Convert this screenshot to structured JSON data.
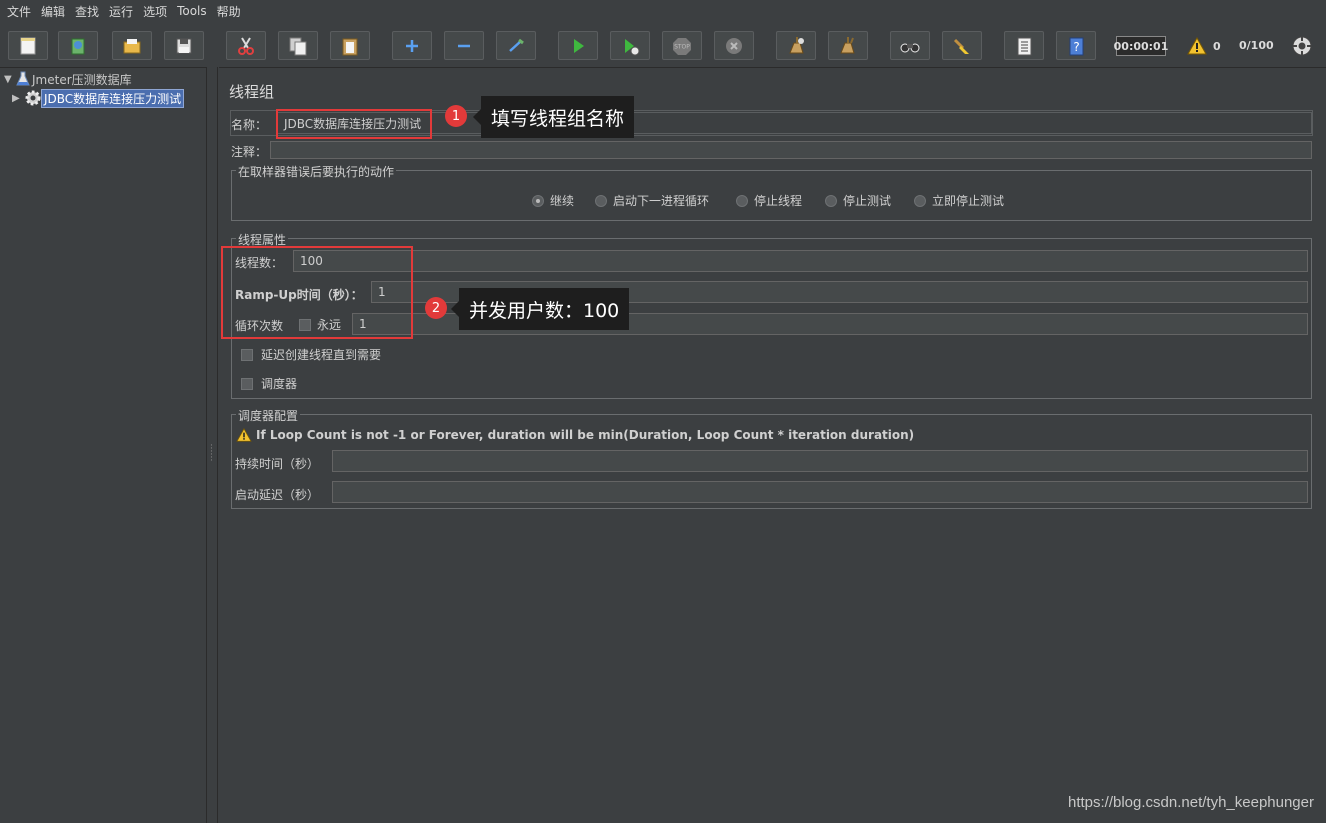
{
  "menu": [
    "文件",
    "编辑",
    "查找",
    "运行",
    "选项",
    "Tools",
    "帮助"
  ],
  "toolbar": {
    "buttons": [
      "new-icon",
      "templates-icon",
      "open-icon",
      "save-icon",
      "cut-icon",
      "copy-icon",
      "paste-icon",
      "expand-icon",
      "collapse-icon",
      "toggle-icon",
      "start-icon",
      "start-no-pause-icon",
      "stop-icon",
      "shutdown-icon",
      "clear-icon",
      "clear-all-icon",
      "search-icon",
      "reset-search-icon",
      "function-helper-icon",
      "help-icon"
    ],
    "timer": "00:00:01",
    "warnings": "0",
    "threads": "0/100"
  },
  "tree": {
    "root": "Jmeter压测数据库",
    "child": "JDBC数据库连接压力测试"
  },
  "panel": {
    "title": "线程组",
    "name_label": "名称：",
    "name_value": "JDBC数据库连接压力测试",
    "comment_label": "注释：",
    "comment_value": "",
    "error_action": {
      "legend": "在取样器错误后要执行的动作",
      "options": [
        "继续",
        "启动下一进程循环",
        "停止线程",
        "停止测试",
        "立即停止测试"
      ],
      "selected": "继续"
    },
    "thread_props": {
      "legend": "线程属性",
      "threads_label": "线程数：",
      "threads_value": "100",
      "rampup_label": "Ramp-Up时间（秒）：",
      "rampup_value": "1",
      "loop_label": "循环次数",
      "forever_label": "永远",
      "loop_value": "1",
      "delay_label": "延迟创建线程直到需要",
      "scheduler_label": "调度器"
    },
    "scheduler": {
      "legend": "调度器配置",
      "warning": "If Loop Count is not -1 or Forever, duration will be min(Duration, Loop Count * iteration duration)",
      "duration_label": "持续时间（秒）",
      "duration_value": "",
      "delay_label": "启动延迟（秒）",
      "delay_value": ""
    }
  },
  "annotations": {
    "one_number": "1",
    "one_text": "填写线程组名称",
    "two_number": "2",
    "two_text": "并发用户数：100",
    "color": "#e23a3a"
  },
  "watermark": "https://blog.csdn.net/tyh_keephunger"
}
